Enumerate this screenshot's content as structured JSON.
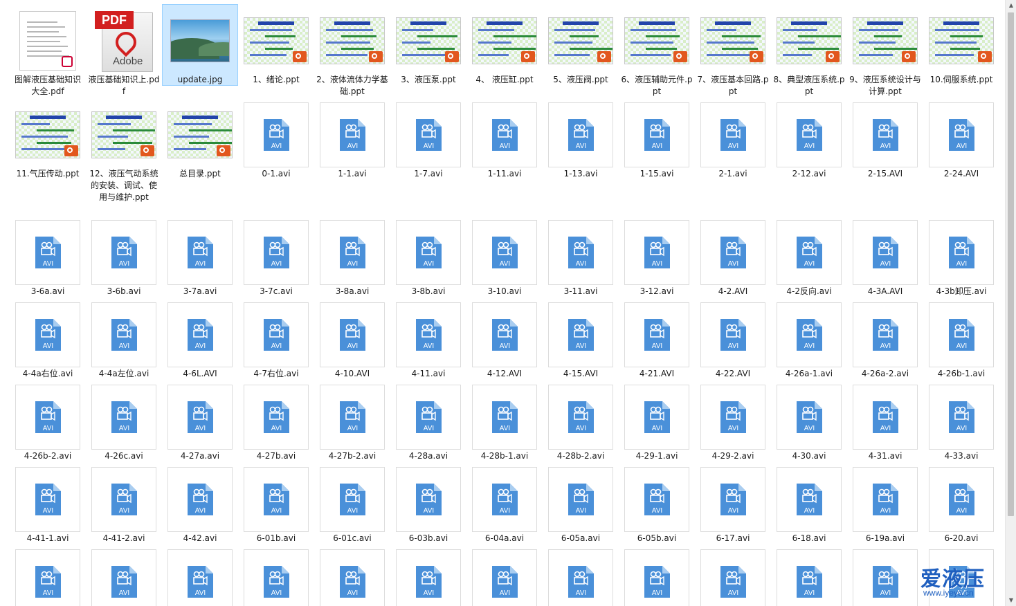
{
  "files": [
    {
      "name": "图解液压基础知识大全.pdf",
      "type": "pdf-doc"
    },
    {
      "name": "液压基础知识上.pdf",
      "type": "pdf-adobe",
      "icon_text": "PDF",
      "icon_brand": "Adobe"
    },
    {
      "name": "update.jpg",
      "type": "jpg",
      "selected": true
    },
    {
      "name": "1、绪论.ppt",
      "type": "ppt"
    },
    {
      "name": "2、液体流体力学基础.ppt",
      "type": "ppt"
    },
    {
      "name": "3、液压泵.ppt",
      "type": "ppt"
    },
    {
      "name": "4、 液压缸.ppt",
      "type": "ppt"
    },
    {
      "name": "5、液压阀.ppt",
      "type": "ppt"
    },
    {
      "name": "6、液压辅助元件.ppt",
      "type": "ppt"
    },
    {
      "name": "7、液压基本回路.ppt",
      "type": "ppt"
    },
    {
      "name": "8、典型液压系统.ppt",
      "type": "ppt"
    },
    {
      "name": "9、液压系统设计与计算.ppt",
      "type": "ppt"
    },
    {
      "name": "10.伺服系统.ppt",
      "type": "ppt"
    },
    {
      "name": "11.气压传动.ppt",
      "type": "ppt"
    },
    {
      "name": "12、液压气动系统的安装、调试、使用与维护.ppt",
      "type": "ppt"
    },
    {
      "name": "总目录.ppt",
      "type": "ppt"
    },
    {
      "name": "0-1.avi",
      "type": "avi"
    },
    {
      "name": "1-1.avi",
      "type": "avi"
    },
    {
      "name": "1-7.avi",
      "type": "avi"
    },
    {
      "name": "1-11.avi",
      "type": "avi"
    },
    {
      "name": "1-13.avi",
      "type": "avi"
    },
    {
      "name": "1-15.avi",
      "type": "avi"
    },
    {
      "name": "2-1.avi",
      "type": "avi"
    },
    {
      "name": "2-12.avi",
      "type": "avi"
    },
    {
      "name": "2-15.AVI",
      "type": "avi"
    },
    {
      "name": "2-24.AVI",
      "type": "avi"
    },
    {
      "name": "3-6a.avi",
      "type": "avi"
    },
    {
      "name": "3-6b.avi",
      "type": "avi"
    },
    {
      "name": "3-7a.avi",
      "type": "avi"
    },
    {
      "name": "3-7c.avi",
      "type": "avi"
    },
    {
      "name": "3-8a.avi",
      "type": "avi"
    },
    {
      "name": "3-8b.avi",
      "type": "avi"
    },
    {
      "name": "3-10.avi",
      "type": "avi"
    },
    {
      "name": "3-11.avi",
      "type": "avi"
    },
    {
      "name": "3-12.avi",
      "type": "avi"
    },
    {
      "name": "4-2.AVI",
      "type": "avi"
    },
    {
      "name": "4-2反向.avi",
      "type": "avi"
    },
    {
      "name": "4-3A.AVI",
      "type": "avi"
    },
    {
      "name": "4-3b卸压.avi",
      "type": "avi"
    },
    {
      "name": "4-4a右位.avi",
      "type": "avi"
    },
    {
      "name": "4-4a左位.avi",
      "type": "avi"
    },
    {
      "name": "4-6L.AVI",
      "type": "avi"
    },
    {
      "name": "4-7右位.avi",
      "type": "avi"
    },
    {
      "name": "4-10.AVI",
      "type": "avi"
    },
    {
      "name": "4-11.avi",
      "type": "avi"
    },
    {
      "name": "4-12.AVI",
      "type": "avi"
    },
    {
      "name": "4-15.AVI",
      "type": "avi"
    },
    {
      "name": "4-21.AVI",
      "type": "avi"
    },
    {
      "name": "4-22.AVI",
      "type": "avi"
    },
    {
      "name": "4-26a-1.avi",
      "type": "avi"
    },
    {
      "name": "4-26a-2.avi",
      "type": "avi"
    },
    {
      "name": "4-26b-1.avi",
      "type": "avi"
    },
    {
      "name": "4-26b-2.avi",
      "type": "avi"
    },
    {
      "name": "4-26c.avi",
      "type": "avi"
    },
    {
      "name": "4-27a.avi",
      "type": "avi"
    },
    {
      "name": "4-27b.avi",
      "type": "avi"
    },
    {
      "name": "4-27b-2.avi",
      "type": "avi"
    },
    {
      "name": "4-28a.avi",
      "type": "avi"
    },
    {
      "name": "4-28b-1.avi",
      "type": "avi"
    },
    {
      "name": "4-28b-2.avi",
      "type": "avi"
    },
    {
      "name": "4-29-1.avi",
      "type": "avi"
    },
    {
      "name": "4-29-2.avi",
      "type": "avi"
    },
    {
      "name": "4-30.avi",
      "type": "avi"
    },
    {
      "name": "4-31.avi",
      "type": "avi"
    },
    {
      "name": "4-33.avi",
      "type": "avi"
    },
    {
      "name": "4-41-1.avi",
      "type": "avi"
    },
    {
      "name": "4-41-2.avi",
      "type": "avi"
    },
    {
      "name": "4-42.avi",
      "type": "avi"
    },
    {
      "name": "6-01b.avi",
      "type": "avi"
    },
    {
      "name": "6-01c.avi",
      "type": "avi"
    },
    {
      "name": "6-03b.avi",
      "type": "avi"
    },
    {
      "name": "6-04a.avi",
      "type": "avi"
    },
    {
      "name": "6-05a.avi",
      "type": "avi"
    },
    {
      "name": "6-05b.avi",
      "type": "avi"
    },
    {
      "name": "6-17.avi",
      "type": "avi"
    },
    {
      "name": "6-18.avi",
      "type": "avi"
    },
    {
      "name": "6-19a.avi",
      "type": "avi"
    },
    {
      "name": "6-20.avi",
      "type": "avi"
    },
    {
      "name": "",
      "type": "avi"
    },
    {
      "name": "",
      "type": "avi"
    },
    {
      "name": "",
      "type": "avi"
    },
    {
      "name": "",
      "type": "avi"
    },
    {
      "name": "",
      "type": "avi"
    },
    {
      "name": "",
      "type": "avi"
    },
    {
      "name": "",
      "type": "avi"
    },
    {
      "name": "",
      "type": "avi"
    },
    {
      "name": "",
      "type": "avi"
    },
    {
      "name": "",
      "type": "avi"
    },
    {
      "name": "",
      "type": "avi"
    },
    {
      "name": "",
      "type": "avi"
    },
    {
      "name": "",
      "type": "avi"
    }
  ],
  "avi_badge_text": "AVI",
  "watermark": {
    "brand": "爱液压",
    "url": "www.iyeya.cn"
  },
  "colors": {
    "selection_bg": "#cce8ff",
    "selection_border": "#99d1ff",
    "avi_blue": "#4a90d9",
    "ppt_orange": "#e2571e"
  }
}
